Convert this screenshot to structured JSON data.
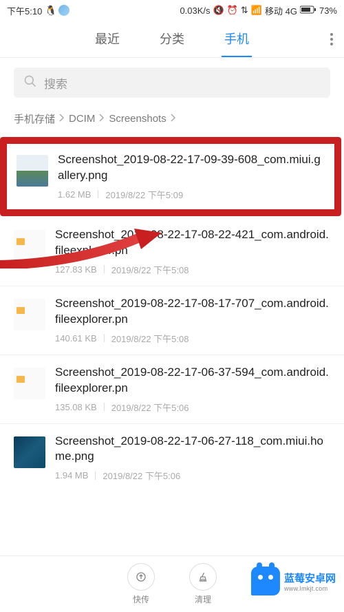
{
  "status_bar": {
    "time": "下午5:10",
    "speed": "0.03K/s",
    "carrier": "移动 4G",
    "battery": "73%"
  },
  "tabs": {
    "recent": "最近",
    "category": "分类",
    "phone": "手机"
  },
  "search": {
    "placeholder": "搜索"
  },
  "breadcrumb": {
    "item0": "手机存储",
    "item1": "DCIM",
    "item2": "Screenshots"
  },
  "files": [
    {
      "name": "Screenshot_2019-08-22-17-09-39-608_com.miui.gallery.png",
      "size": "1.62 MB",
      "date": "2019/8/22 下午5:09",
      "thumb": "gallery",
      "highlighted": true
    },
    {
      "name": "Screenshot_2019-08-22-17-08-22-421_com.android.fileexplorer.pn",
      "size": "127.83 KB",
      "date": "2019/8/22 下午5:08",
      "thumb": "fileexp"
    },
    {
      "name": "Screenshot_2019-08-22-17-08-17-707_com.android.fileexplorer.pn",
      "size": "140.61 KB",
      "date": "2019/8/22 下午5:08",
      "thumb": "fileexp"
    },
    {
      "name": "Screenshot_2019-08-22-17-06-37-594_com.android.fileexplorer.pn",
      "size": "135.08 KB",
      "date": "2019/8/22 下午5:06",
      "thumb": "fileexp"
    },
    {
      "name": "Screenshot_2019-08-22-17-06-27-118_com.miui.home.png",
      "size": "1.94 MB",
      "date": "2019/8/22 下午5:06",
      "thumb": "home"
    }
  ],
  "bottom": {
    "transfer": "快传",
    "clean": "清理"
  },
  "watermark": {
    "main": "蓝莓安卓网",
    "sub": "www.lmkjt.com"
  }
}
